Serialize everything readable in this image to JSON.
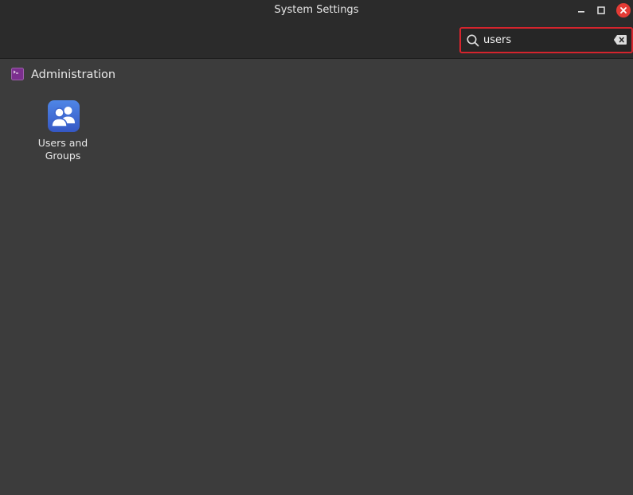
{
  "window": {
    "title": "System Settings",
    "controls": {
      "minimize_icon": "minimize-icon",
      "maximize_icon": "maximize-icon",
      "close_icon": "close-icon",
      "close_color": "#e43b35"
    }
  },
  "search": {
    "value": "users",
    "placeholder": "",
    "focus_border_color": "#d5242d",
    "icon": "search-icon",
    "clear_icon": "clear-icon"
  },
  "results": {
    "section": {
      "title": "Administration",
      "icon": "terminal-icon",
      "icon_color": "#7b2f8e"
    },
    "items": [
      {
        "label": "Users and Groups",
        "icon": "users-groups-icon",
        "icon_color": "#3f6fd8"
      }
    ]
  }
}
